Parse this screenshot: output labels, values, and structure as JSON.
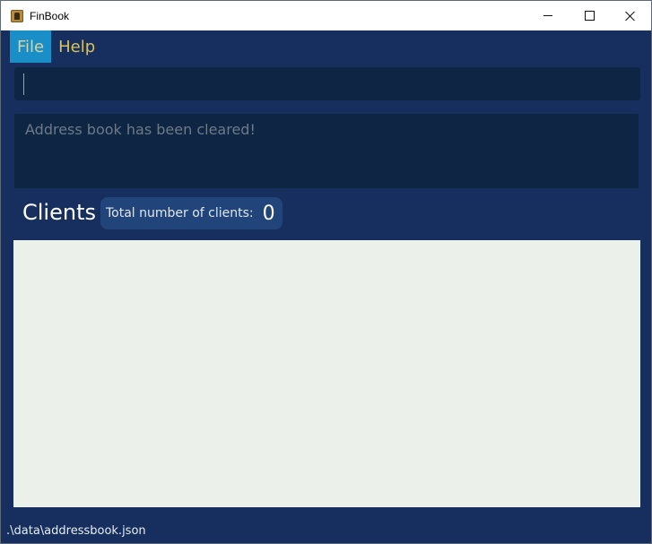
{
  "window": {
    "title": "FinBook",
    "controls": [
      "minimize",
      "maximize",
      "close"
    ]
  },
  "menu": {
    "items": [
      {
        "label": "File",
        "active": true
      },
      {
        "label": "Help",
        "active": false
      }
    ]
  },
  "command_box": {
    "value": "",
    "placeholder": ""
  },
  "result_display": {
    "text": "Address book has been cleared!"
  },
  "clients_panel": {
    "title": "Clients",
    "count_label": "Total number of clients:",
    "count_value": "0",
    "items": []
  },
  "status_bar": {
    "path": ".\\data\\addressbook.json"
  },
  "colors": {
    "background": "#172f5e",
    "menu_text": "#d7c25c",
    "menu_active_bg": "#1a8fc7",
    "input_bg": "#0e2644",
    "list_bg": "#ecf0ea",
    "pill_bg": "#21457b"
  }
}
